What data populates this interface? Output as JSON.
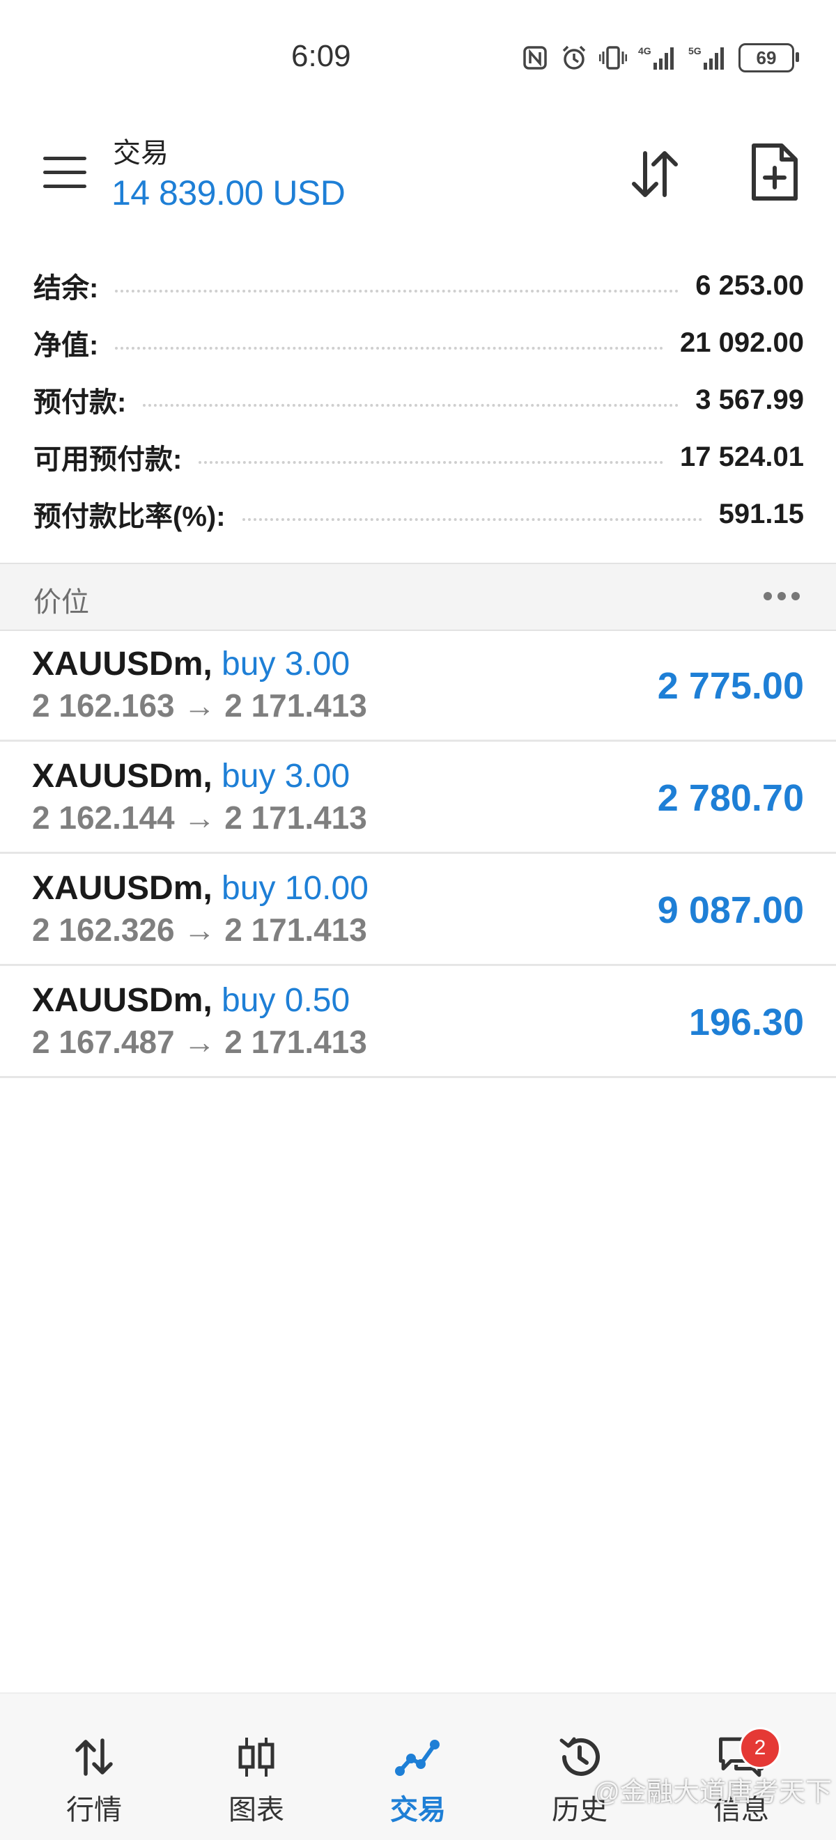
{
  "status_bar": {
    "time": "6:09",
    "battery": "69",
    "icons": [
      "nfc-icon",
      "alarm-icon",
      "vibrate-icon",
      "signal-4g-icon",
      "signal-5g-icon",
      "battery-icon"
    ]
  },
  "header": {
    "title": "交易",
    "balance": "14 839.00 USD"
  },
  "summary": [
    {
      "label": "结余:",
      "value": "6 253.00"
    },
    {
      "label": "净值:",
      "value": "21 092.00"
    },
    {
      "label": "预付款:",
      "value": "3 567.99"
    },
    {
      "label": "可用预付款:",
      "value": "17 524.01"
    },
    {
      "label": "预付款比率(%):",
      "value": "591.15"
    }
  ],
  "section": {
    "title": "价位"
  },
  "positions": [
    {
      "symbol": "XAUUSDm,",
      "side": "buy 3.00",
      "prices": "2 162.163 → 2 171.413",
      "profit": "2 775.00"
    },
    {
      "symbol": "XAUUSDm,",
      "side": "buy 3.00",
      "prices": "2 162.144 → 2 171.413",
      "profit": "2 780.70"
    },
    {
      "symbol": "XAUUSDm,",
      "side": "buy 10.00",
      "prices": "2 162.326 → 2 171.413",
      "profit": "9 087.00"
    },
    {
      "symbol": "XAUUSDm,",
      "side": "buy 0.50",
      "prices": "2 167.487 → 2 171.413",
      "profit": "196.30"
    }
  ],
  "nav": {
    "items": [
      {
        "label": "行情",
        "icon": "quotes-arrows-icon"
      },
      {
        "label": "图表",
        "icon": "candlestick-chart-icon"
      },
      {
        "label": "交易",
        "icon": "trade-line-icon"
      },
      {
        "label": "历史",
        "icon": "history-clock-icon"
      },
      {
        "label": "信息",
        "icon": "messages-chat-icon",
        "badge": "2"
      }
    ],
    "active_index": 2
  },
  "watermark": "@金融大道唐考天下",
  "colors": {
    "accent": "#1e7fd6",
    "badge": "#e53935",
    "text": "#1a1a1a",
    "muted": "#7f7f7f"
  }
}
